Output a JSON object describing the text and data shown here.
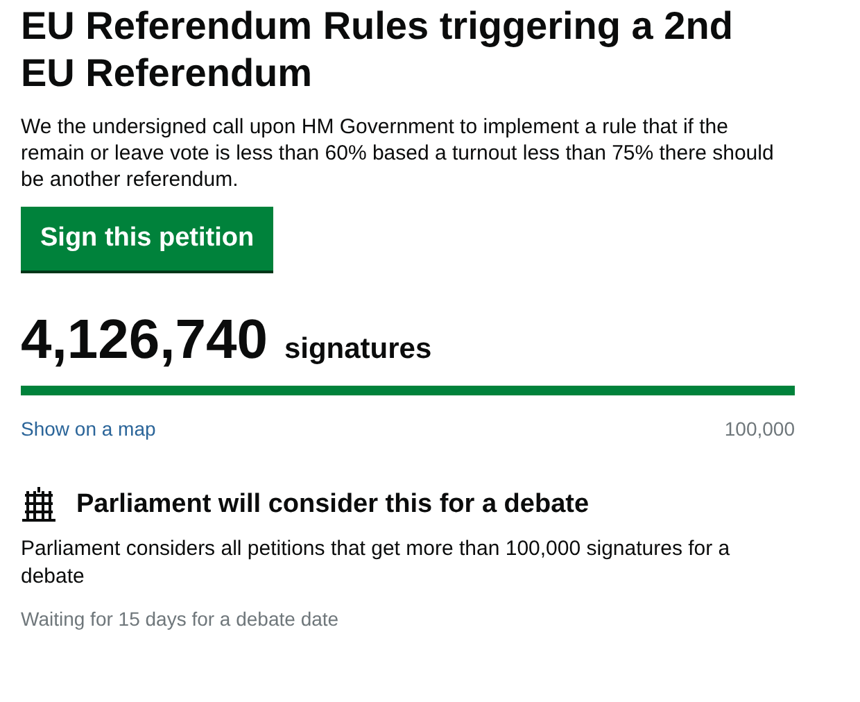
{
  "title": "EU Referendum Rules triggering a 2nd EU Referendum",
  "description": "We the undersigned call upon HM Government to implement a rule that if the remain or leave vote is less than 60% based a turnout less than 75% there should be another referendum.",
  "sign_button": "Sign this petition",
  "signatures": {
    "count": "4,126,740",
    "label": "signatures",
    "level": 1
  },
  "map_link": "Show on a map",
  "threshold": "100,000",
  "debate": {
    "heading": "Parliament will consider this for a debate",
    "text": "Parliament considers all petitions that get more than 100,000 signatures for a debate",
    "status": "Waiting for 15 days for a debate date"
  }
}
